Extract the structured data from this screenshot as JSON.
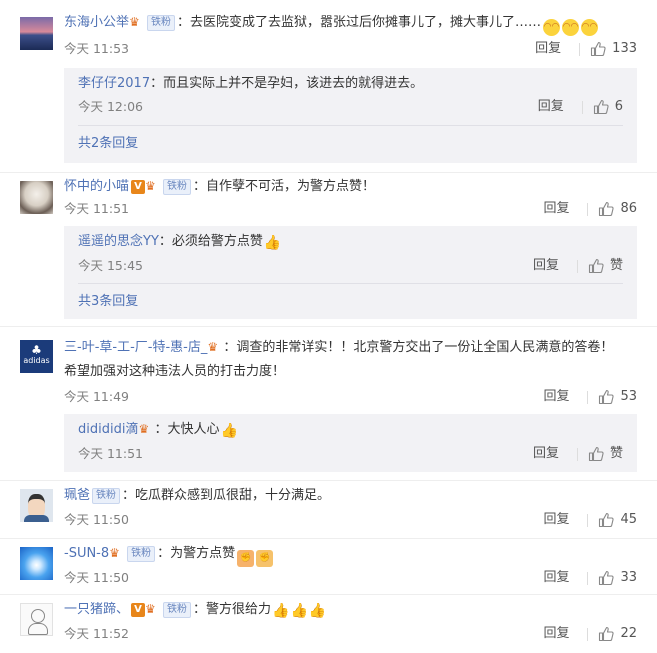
{
  "comments": [
    {
      "user": "东海小公举",
      "fan_badge": "铁粉",
      "text": "：去医院变成了去监狱，嚣张过后你摊事儿了，摊大事儿了……",
      "time": "今天 11:53",
      "reply": "回复",
      "likes": "133",
      "avatar": "sunset-lake-avatar",
      "sub": [
        {
          "user": "李仔仔2017",
          "text": "：而且实际上并不是孕妇，该进去的就得进去。",
          "time": "今天 12:06",
          "reply": "回复",
          "likes": "6"
        }
      ],
      "more": "共2条回复"
    },
    {
      "user": "怀中的小喵",
      "vip": "V",
      "fan_badge": "铁粉",
      "text": "：自作孽不可活，为警方点赞！",
      "time": "今天 11:51",
      "reply": "回复",
      "likes": "86",
      "avatar": "cat-avatar",
      "sub": [
        {
          "user": "遥遥的思念YY",
          "text": "：必须给警方点赞",
          "time": "今天 15:45",
          "reply": "回复",
          "likes": "赞"
        }
      ],
      "more": "共3条回复"
    },
    {
      "user": "三-叶-草-工-厂-特-惠-店_",
      "text": "：调查的非常详实！！北京警方交出了一份让全国人民满意的答卷！",
      "text2": "希望加强对这种违法人员的打击力度！",
      "time": "今天 11:49",
      "reply": "回复",
      "likes": "53",
      "avatar": "adidas-logo-avatar",
      "avatar_text": "adidas",
      "sub": [
        {
          "user": "didididi滴",
          "text": "：大快人心",
          "time": "今天 11:51",
          "reply": "回复",
          "likes": "赞"
        }
      ]
    },
    {
      "user": "珮爸",
      "fan_badge": "铁粉",
      "text": "：吃瓜群众感到瓜很甜，十分满足。",
      "time": "今天 11:50",
      "reply": "回复",
      "likes": "45",
      "avatar": "cartoon-man-avatar"
    },
    {
      "user": "-SUN-8",
      "fan_badge": "铁粉",
      "text": "：为警方点赞",
      "time": "今天 11:50",
      "reply": "回复",
      "likes": "33",
      "avatar": "blue-sun-avatar"
    },
    {
      "user": "一只猪蹄、",
      "vip": "V",
      "fan_badge": "铁粉",
      "text": "：警方很给力",
      "time": "今天 11:52",
      "reply": "回复",
      "likes": "22",
      "avatar": "sketch-avatar"
    }
  ],
  "colors": {
    "username": "#4f72b5",
    "time": "#808080",
    "sub_bg": "#f2f2f5",
    "vip": "#e8861a"
  }
}
